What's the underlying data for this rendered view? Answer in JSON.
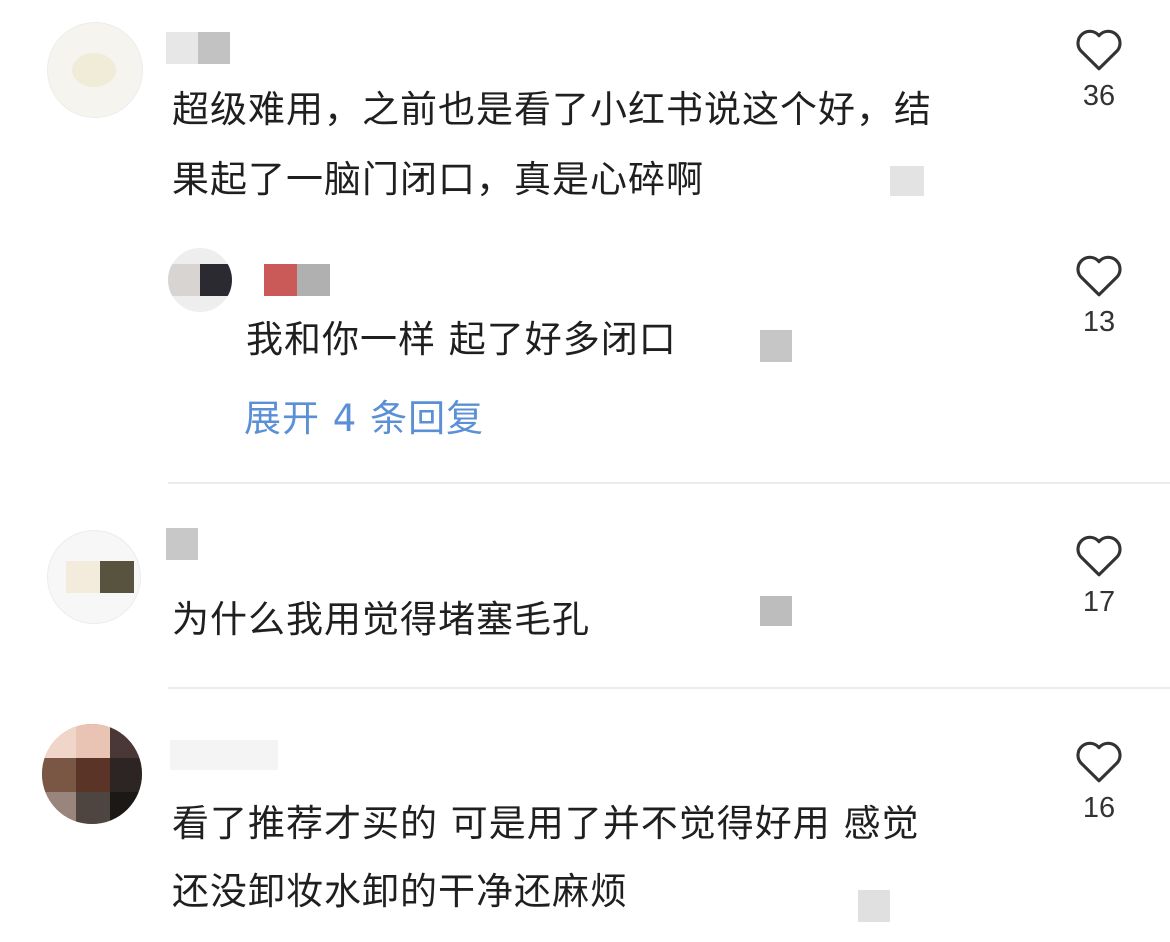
{
  "comments": [
    {
      "text_line1": "超级难用，之前也是看了小红书说这个好，结",
      "text_line2": "果起了一脑门闭口，真是心碎啊",
      "likes": "36",
      "reply": {
        "text": "我和你一样 起了好多闭口",
        "likes": "13"
      },
      "expand_label": "展开 4 条回复"
    },
    {
      "text_line1": "为什么我用觉得堵塞毛孔",
      "likes": "17"
    },
    {
      "text_line1": "看了推荐才买的 可是用了并不觉得好用 感觉",
      "text_line2": "还没卸妆水卸的干净还麻烦",
      "likes": "16"
    }
  ],
  "colors": {
    "link": "#5b8fd6",
    "text": "#1f1f1f",
    "divider": "#ededed",
    "icon": "#333333"
  },
  "icons": {
    "like": "heart-outline-icon"
  }
}
